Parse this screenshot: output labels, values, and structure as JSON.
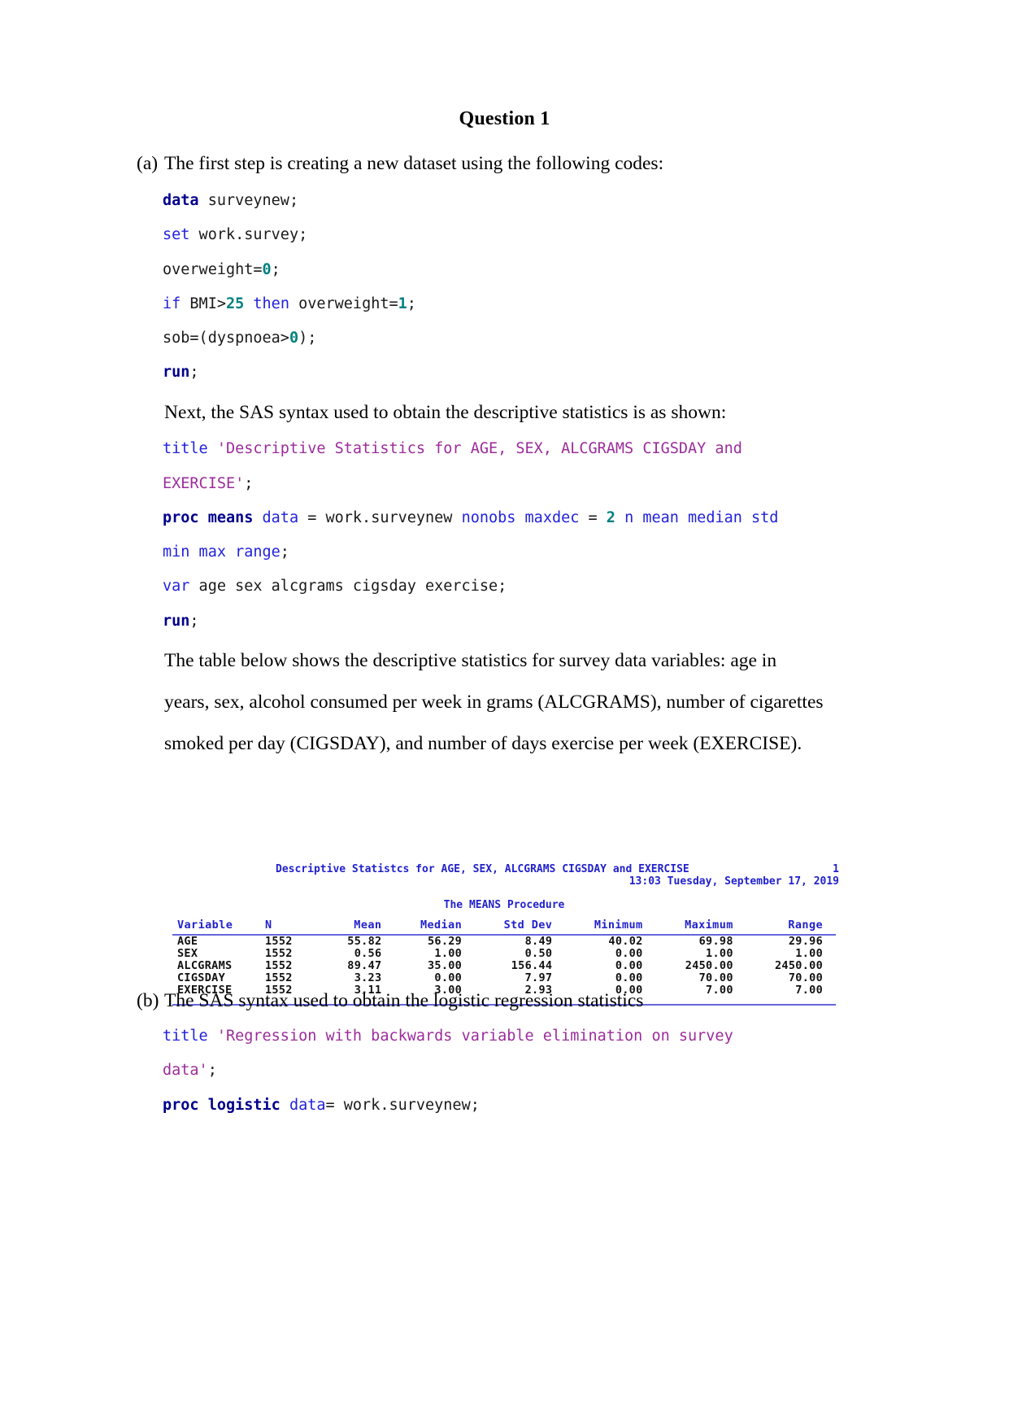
{
  "document": {
    "title": "Question 1"
  },
  "sections": [
    {
      "marker": "(a)",
      "intro": "The first step is creating a new dataset using the following codes:",
      "code_block_1": [
        {
          "tokens": [
            {
              "t": "data",
              "c": "kw-bold"
            },
            {
              "t": " surveynew;",
              "c": "plain"
            }
          ]
        },
        {
          "tokens": [
            {
              "t": "set",
              "c": "kw"
            },
            {
              "t": " work.survey;",
              "c": "plain"
            }
          ]
        },
        {
          "tokens": [
            {
              "t": "overweight=",
              "c": "plain"
            },
            {
              "t": "0",
              "c": "num"
            },
            {
              "t": ";",
              "c": "plain"
            }
          ]
        },
        {
          "tokens": [
            {
              "t": "if",
              "c": "kw"
            },
            {
              "t": " BMI>",
              "c": "plain"
            },
            {
              "t": "25",
              "c": "num"
            },
            {
              "t": " ",
              "c": "plain"
            },
            {
              "t": "then",
              "c": "kw"
            },
            {
              "t": " overweight=",
              "c": "plain"
            },
            {
              "t": "1",
              "c": "num"
            },
            {
              "t": ";",
              "c": "plain"
            }
          ]
        },
        {
          "tokens": [
            {
              "t": "sob=(dyspnoea>",
              "c": "plain"
            },
            {
              "t": "0",
              "c": "num"
            },
            {
              "t": ");",
              "c": "plain"
            }
          ]
        },
        {
          "tokens": [
            {
              "t": "run",
              "c": "kw-bold"
            },
            {
              "t": ";",
              "c": "plain"
            }
          ]
        }
      ],
      "mid_text": "Next, the SAS syntax used to obtain the descriptive statistics is as shown:",
      "code_block_2": [
        {
          "tokens": [
            {
              "t": "title",
              "c": "kw"
            },
            {
              "t": " 'Descriptive Statistics for AGE, SEX, ALCGRAMS CIGSDAY and",
              "c": "str"
            }
          ]
        },
        {
          "tokens": [
            {
              "t": "EXERCISE'",
              "c": "str"
            },
            {
              "t": ";",
              "c": "plain"
            }
          ]
        },
        {
          "tokens": [
            {
              "t": "proc means",
              "c": "kw-bold"
            },
            {
              "t": " ",
              "c": "plain"
            },
            {
              "t": "data",
              "c": "kw"
            },
            {
              "t": " = work.surveynew ",
              "c": "plain"
            },
            {
              "t": "nonobs maxdec",
              "c": "kw"
            },
            {
              "t": " = ",
              "c": "plain"
            },
            {
              "t": "2",
              "c": "num"
            },
            {
              "t": " ",
              "c": "plain"
            },
            {
              "t": "n mean median std",
              "c": "kw"
            }
          ]
        },
        {
          "tokens": [
            {
              "t": "min max range",
              "c": "kw"
            },
            {
              "t": ";",
              "c": "plain"
            }
          ]
        },
        {
          "tokens": [
            {
              "t": "var",
              "c": "kw"
            },
            {
              "t": " age sex alcgrams cigsday exercise;",
              "c": "plain"
            }
          ]
        },
        {
          "tokens": [
            {
              "t": "run",
              "c": "kw-bold"
            },
            {
              "t": ";",
              "c": "plain"
            }
          ]
        }
      ],
      "table_caption_lines": [
        "The table below shows the descriptive statistics for survey data variables: age in",
        "years, sex, alcohol consumed per week in grams (ALCGRAMS), number of cigarettes",
        "smoked per day (CIGSDAY), and number of days exercise per week (EXERCISE)."
      ]
    },
    {
      "marker": "(b)",
      "intro": "The SAS syntax used to obtain the logistic regression statistics",
      "code_block_1": [
        {
          "tokens": [
            {
              "t": "title",
              "c": "kw"
            },
            {
              "t": " 'Regression with backwards variable elimination on survey",
              "c": "str"
            }
          ]
        },
        {
          "tokens": [
            {
              "t": "data'",
              "c": "str"
            },
            {
              "t": ";",
              "c": "plain"
            }
          ]
        },
        {
          "tokens": [
            {
              "t": "proc logistic",
              "c": "kw-bold"
            },
            {
              "t": " ",
              "c": "plain"
            },
            {
              "t": "data",
              "c": "kw"
            },
            {
              "t": "= work.surveynew;",
              "c": "plain"
            }
          ]
        }
      ]
    }
  ],
  "sas_output": {
    "title": "Descriptive Statistcs for AGE, SEX, ALCGRAMS CIGSDAY and EXERCISE",
    "page_number": "1",
    "timestamp": "13:03 Tuesday, September 17, 2019",
    "procedure": "The MEANS Procedure",
    "accent_color": "#2222cc",
    "rule_color": "#6666dd",
    "chart_data": {
      "type": "table",
      "title": "Descriptive Statistcs for AGE, SEX, ALCGRAMS CIGSDAY and EXERCISE",
      "columns": [
        "Variable",
        "N",
        "Mean",
        "Median",
        "Std Dev",
        "Minimum",
        "Maximum",
        "Range"
      ],
      "rows": [
        [
          "AGE",
          "1552",
          "55.82",
          "56.29",
          "8.49",
          "40.02",
          "69.98",
          "29.96"
        ],
        [
          "SEX",
          "1552",
          "0.56",
          "1.00",
          "0.50",
          "0.00",
          "1.00",
          "1.00"
        ],
        [
          "ALCGRAMS",
          "1552",
          "89.47",
          "35.00",
          "156.44",
          "0.00",
          "2450.00",
          "2450.00"
        ],
        [
          "CIGSDAY",
          "1552",
          "3.23",
          "0.00",
          "7.97",
          "0.00",
          "70.00",
          "70.00"
        ],
        [
          "EXERCISE",
          "1552",
          "3.11",
          "3.00",
          "2.93",
          "0.00",
          "7.00",
          "7.00"
        ]
      ]
    }
  }
}
